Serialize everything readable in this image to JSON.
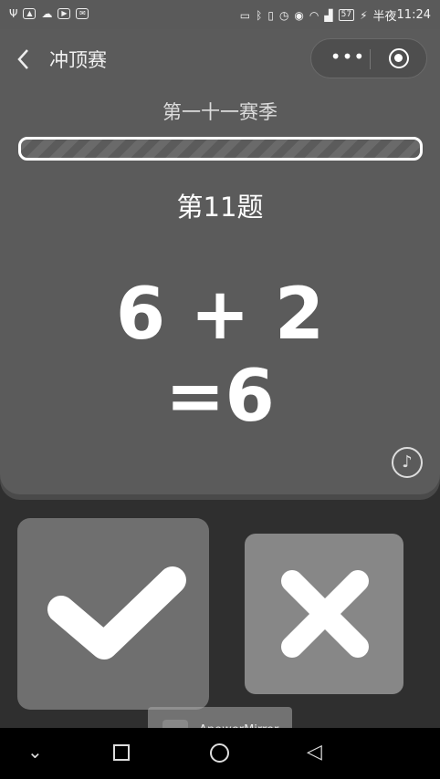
{
  "status_bar": {
    "time": "11:24",
    "time_prefix": "半夜",
    "battery": "57"
  },
  "header": {
    "back_icon": "chevron-left-icon",
    "title": "冲顶赛",
    "more_icon": "more-dots-icon",
    "close_icon": "target-close-icon"
  },
  "quiz": {
    "season": "第一十一赛季",
    "progress": 0.0,
    "question_number": "第11题",
    "equation_line1": "6 + 2",
    "equation_line2": "=6",
    "music_icon": "music-note-icon"
  },
  "answers": {
    "true_icon": "checkmark-icon",
    "false_icon": "cross-icon"
  },
  "watermark": {
    "text": "ApowerMirror"
  },
  "colors": {
    "card_bg": "#5b5b5b",
    "page_bg": "#2f2f2f",
    "true_btn": "#6f6f6f",
    "false_btn": "#878787"
  }
}
